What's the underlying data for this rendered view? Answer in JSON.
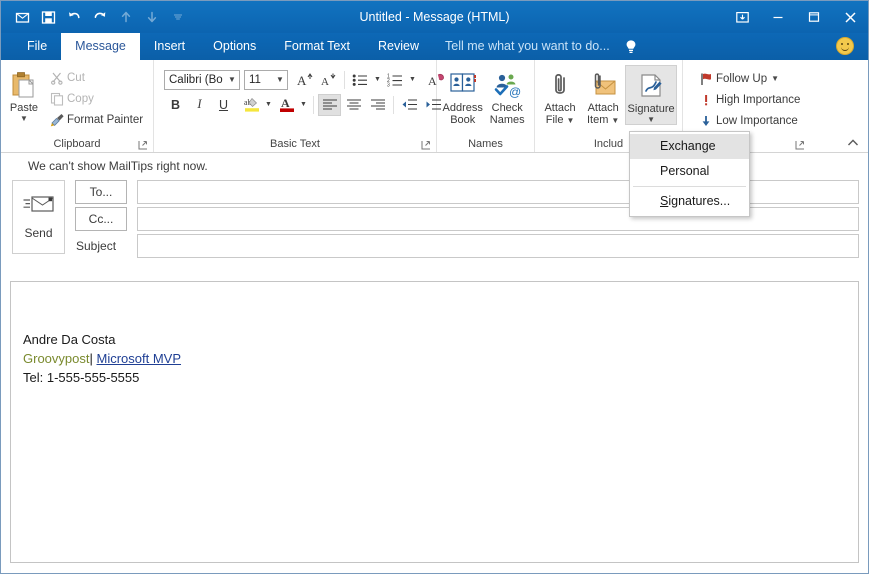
{
  "window": {
    "title": "Untitled - Message (HTML)",
    "accent": "#0f6cbd",
    "quick_access": [
      {
        "name": "envelope-icon",
        "label": "Send to Mail Recipient"
      },
      {
        "name": "save-icon",
        "label": "Save"
      },
      {
        "name": "undo-icon",
        "label": "Undo"
      },
      {
        "name": "redo-icon",
        "label": "Redo"
      },
      {
        "name": "up-arrow-icon",
        "label": "Previous Item"
      },
      {
        "name": "down-arrow-icon",
        "label": "Next Item"
      },
      {
        "name": "chevron-down-icon",
        "label": "Customize Quick Access Toolbar"
      }
    ],
    "controls": {
      "ribbon_display": "Ribbon Display Options",
      "minimize": "Minimize",
      "restore": "Restore Down",
      "close": "Close"
    }
  },
  "tabs": [
    {
      "label": "File",
      "active": false
    },
    {
      "label": "Message",
      "active": true
    },
    {
      "label": "Insert",
      "active": false
    },
    {
      "label": "Options",
      "active": false
    },
    {
      "label": "Format Text",
      "active": false
    },
    {
      "label": "Review",
      "active": false
    }
  ],
  "tellme": {
    "placeholder": "Tell me what you want to do...",
    "bulb": "lightbulb-icon"
  },
  "ribbon": {
    "collapse_label": "Collapse the Ribbon",
    "groups": {
      "clipboard": {
        "label": "Clipboard",
        "paste": "Paste",
        "cut": "Cut",
        "copy": "Copy",
        "format_painter": "Format Painter",
        "launcher": "Clipboard dialog launcher"
      },
      "basic_text": {
        "label": "Basic Text",
        "font_name": "Calibri (Bo",
        "font_size": "11",
        "grow_font": "Grow Font",
        "shrink_font": "Shrink Font",
        "bullets": "Bullets",
        "numbering": "Numbering",
        "clear_formatting": "Clear All Formatting",
        "bold": "B",
        "italic": "I",
        "underline": "U",
        "highlight": "Text Highlight Color",
        "font_color": "Font Color",
        "align_left": "Align Left",
        "align_center": "Center",
        "align_right": "Align Right",
        "decrease_indent": "Decrease Indent",
        "increase_indent": "Increase Indent",
        "launcher": "Font dialog launcher"
      },
      "names": {
        "label": "Names",
        "address_book": "Address\nBook",
        "address_book_l1": "Address",
        "address_book_l2": "Book",
        "check_names_l1": "Check",
        "check_names_l2": "Names"
      },
      "include": {
        "label": "Includ",
        "attach_file_l1": "Attach",
        "attach_file_l2": "File",
        "attach_item_l1": "Attach",
        "attach_item_l2": "Item",
        "signature": "Signature"
      },
      "tags": {
        "label": "s",
        "follow_up": "Follow Up",
        "high_importance": "High Importance",
        "low_importance": "Low Importance",
        "launcher": "Tags dialog launcher"
      }
    }
  },
  "signature_menu": {
    "items": [
      {
        "label": "Exchange",
        "selected": true
      },
      {
        "label": "Personal",
        "selected": false
      }
    ],
    "more": "Signatures...",
    "more_first_char": "S",
    "more_rest": "ignatures..."
  },
  "mailtips": {
    "text": "We can't show MailTips right now."
  },
  "compose": {
    "send_label": "Send",
    "to_label": "To...",
    "to_value": "",
    "cc_label": "Cc...",
    "cc_value": "",
    "subject_label": "Subject",
    "subject_value": ""
  },
  "body": {
    "signature": {
      "name": "Andre Da Costa",
      "site": "Groovypost",
      "separator": "|",
      "link": "Microsoft MVP",
      "phone": "Tel: 1-555-555-5555"
    },
    "colors": {
      "site": "#7a8a2e",
      "link": "#1f3f94"
    }
  }
}
